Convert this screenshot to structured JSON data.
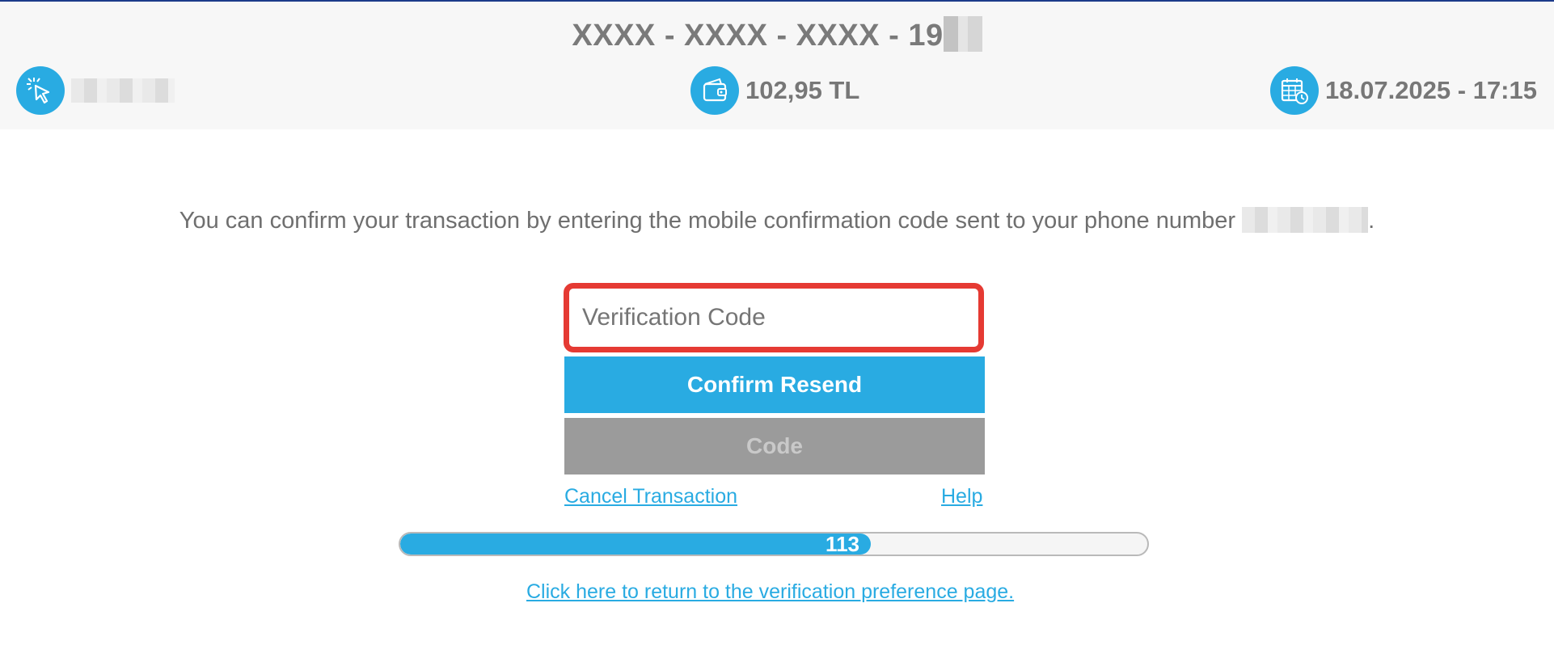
{
  "header": {
    "card_number": "XXXX - XXXX - XXXX - 19",
    "balance": "102,95 TL",
    "datetime": "18.07.2025 - 17:15",
    "icons": [
      "click-cursor-icon",
      "wallet-icon",
      "calendar-clock-icon"
    ]
  },
  "main": {
    "message": "You can confirm your transaction by entering the mobile confirmation code sent to your phone number",
    "message_end": ".",
    "input": {
      "placeholder": "Verification Code",
      "value": ""
    },
    "confirm_button": "Confirm Resend",
    "code_button": "Code",
    "cancel_link": "Cancel Transaction",
    "help_link": "Help",
    "timer": {
      "remaining_seconds": "113",
      "fill_fraction": 0.63
    },
    "return_link": "Click here to return to the verification preference page."
  },
  "colors": {
    "accent": "#29abe2",
    "input_border": "#e53a33",
    "disabled_button": "#9b9b9b",
    "header_bg": "#f7f7f7"
  }
}
